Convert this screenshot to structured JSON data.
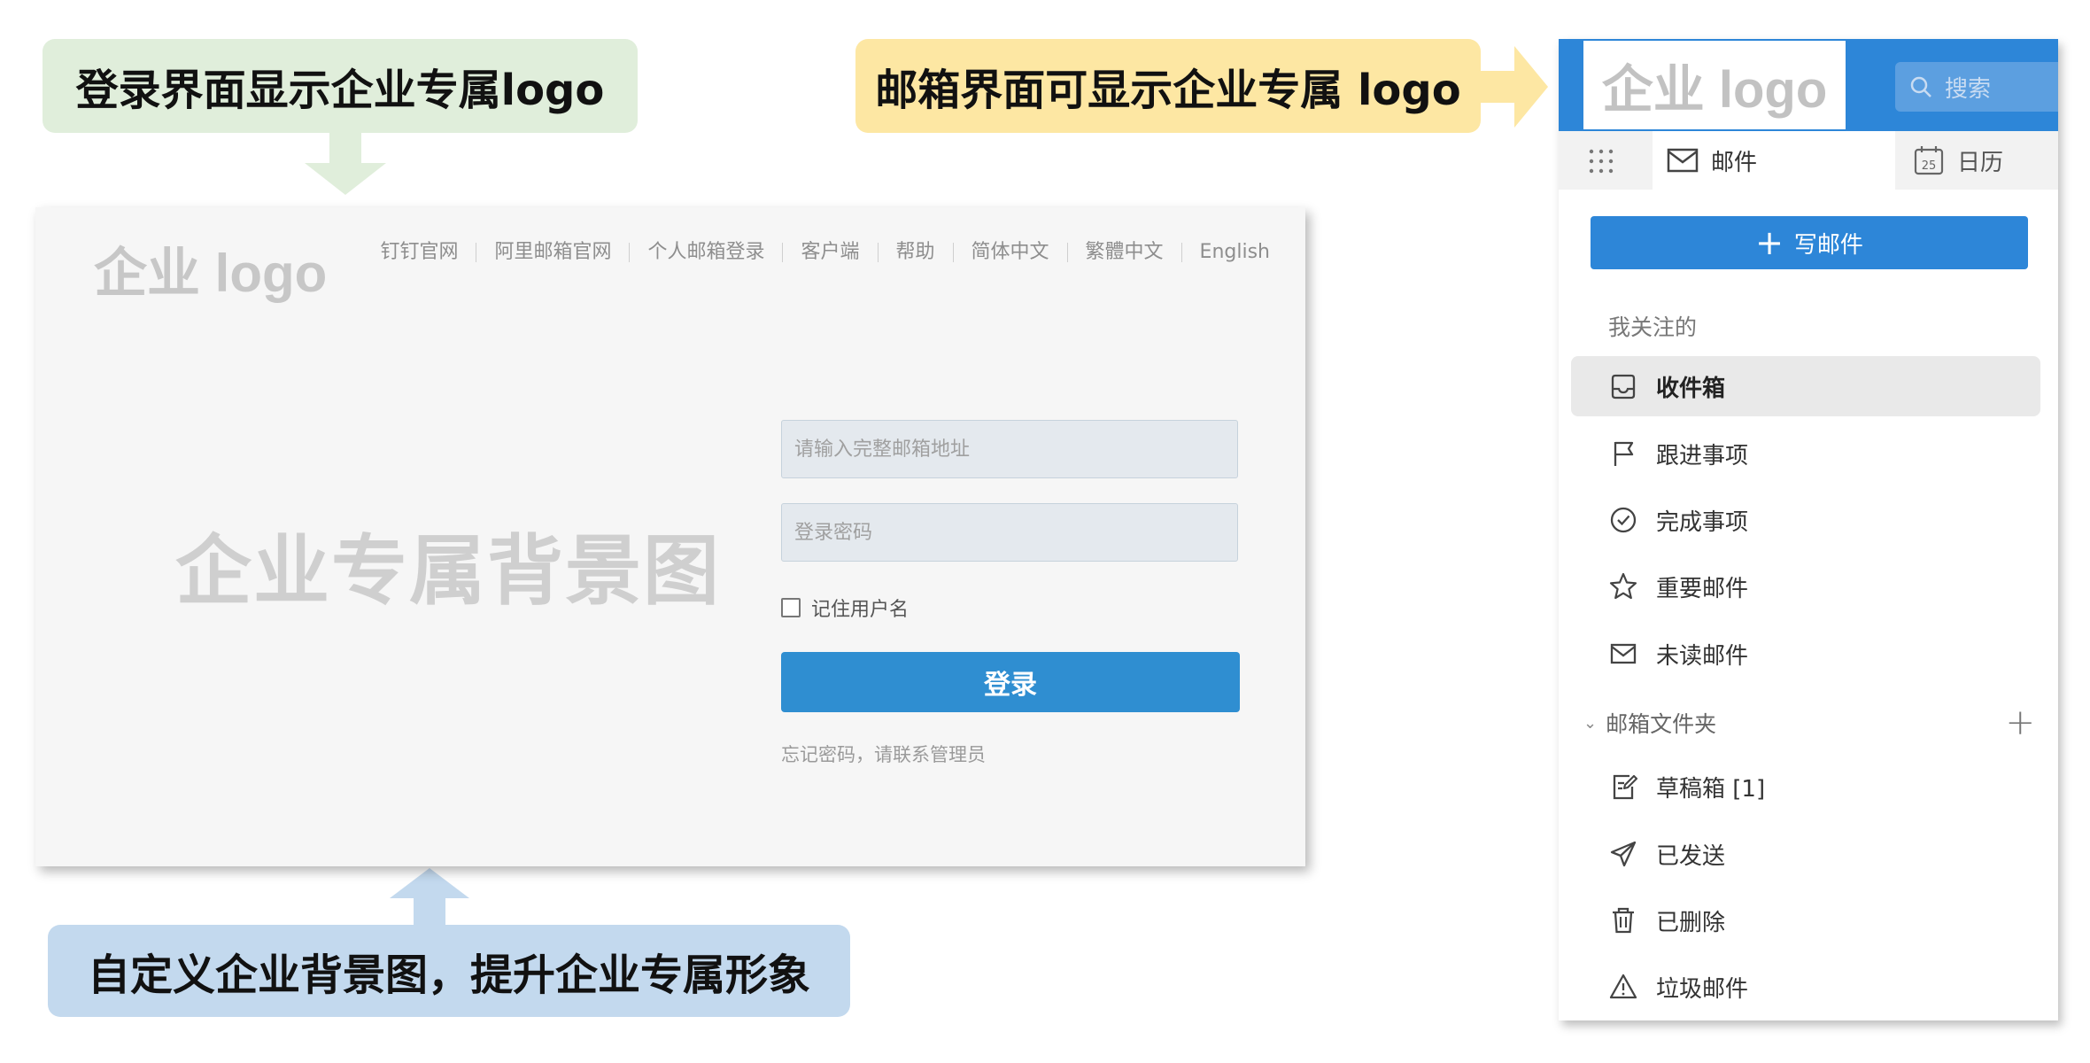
{
  "callouts": {
    "login_logo": "登录界面显示企业专属logo",
    "mail_logo": "邮箱界面可显示企业专属 logo",
    "background": "自定义企业背景图，提升企业专属形象"
  },
  "colors": {
    "green_callout": "#e0eedb",
    "yellow_callout": "#fde7a3",
    "blue_callout": "#c3d9ee",
    "accent": "#2d86d8",
    "login_button": "#2f8ed1"
  },
  "login": {
    "logo": "企业 logo",
    "nav": [
      "钉钉官网",
      "阿里邮箱官网",
      "个人邮箱登录",
      "客户端",
      "帮助",
      "简体中文",
      "繁體中文",
      "English"
    ],
    "background_text": "企业专属背景图",
    "email_placeholder": "请输入完整邮箱地址",
    "password_placeholder": "登录密码",
    "remember": "记住用户名",
    "submit": "登录",
    "forgot": "忘记密码，请联系管理员"
  },
  "mail": {
    "logo": "企业 logo",
    "search": "搜索",
    "tabs": {
      "mail": "邮件",
      "calendar": "日历",
      "calendar_day": "25"
    },
    "compose": "写邮件",
    "followed_label": "我关注的",
    "followed": [
      {
        "label": "收件箱",
        "icon": "inbox-icon"
      },
      {
        "label": "跟进事项",
        "icon": "flag-icon"
      },
      {
        "label": "完成事项",
        "icon": "check-circle-icon"
      },
      {
        "label": "重要邮件",
        "icon": "star-icon"
      },
      {
        "label": "未读邮件",
        "icon": "envelope-icon"
      }
    ],
    "folders_label": "邮箱文件夹",
    "folders": [
      {
        "label": "草稿箱 [1]",
        "icon": "draft-icon"
      },
      {
        "label": "已发送",
        "icon": "send-icon"
      },
      {
        "label": "已删除",
        "icon": "trash-icon"
      },
      {
        "label": "垃圾邮件",
        "icon": "warning-icon"
      }
    ]
  }
}
